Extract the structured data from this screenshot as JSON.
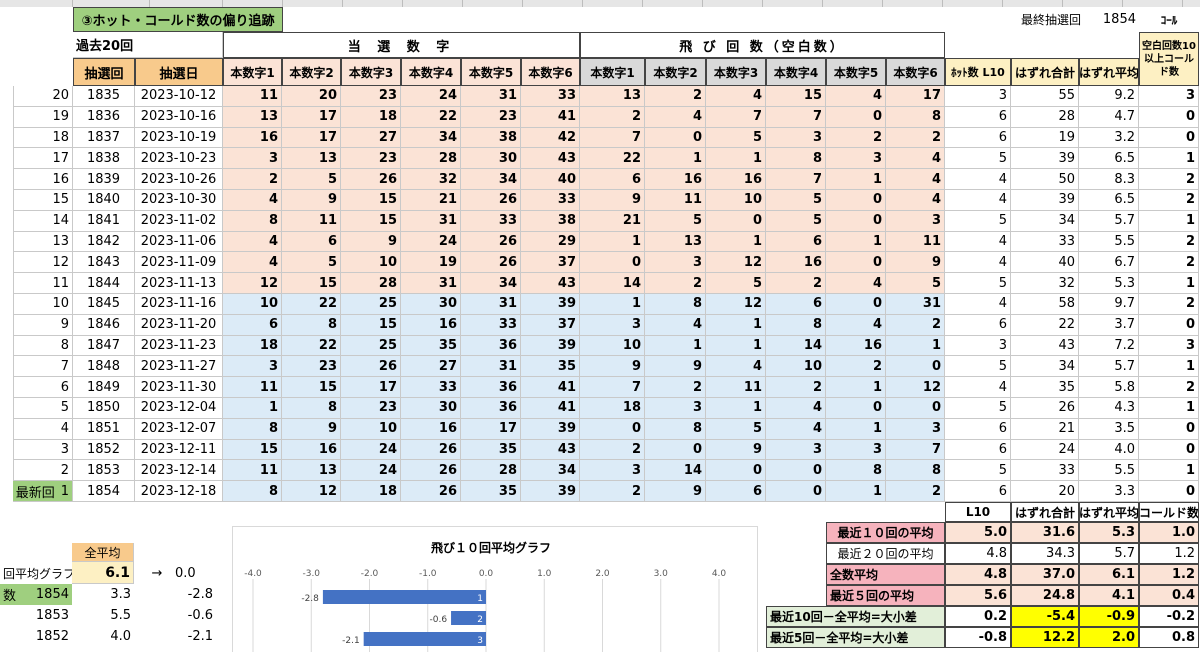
{
  "title": "③ホット・コールド数の偏り追跡",
  "last_draw_label": "最終抽選回",
  "last_draw_value": "1854",
  "cold_label": "ｺｰﾙ",
  "past_label": "過去20回",
  "winning_header": "当 選 数 字",
  "skip_header": "飛 び 回 数（空白数）",
  "blank_header": "空白回数10以上コールド数",
  "col_headers": {
    "draw": "抽選回",
    "date": "抽選日",
    "win": [
      "本数字1",
      "本数字2",
      "本数字3",
      "本数字4",
      "本数字5",
      "本数字6"
    ],
    "skip": [
      "本数字1",
      "本数字2",
      "本数字3",
      "本数字4",
      "本数字5",
      "本数字6"
    ],
    "hot": "ﾎｯﾄ数 L10",
    "miss_total": "はずれ合計",
    "miss_avg": "はずれ平均"
  },
  "latest_label": "最新回",
  "rows": [
    {
      "idx": "20",
      "draw": "1835",
      "date": "2023-10-12",
      "win": [
        "11",
        "20",
        "23",
        "24",
        "31",
        "33"
      ],
      "skip": [
        "13",
        "2",
        "4",
        "15",
        "4",
        "17"
      ],
      "hot": "3",
      "total": "55",
      "avg": "9.2",
      "cold": "3"
    },
    {
      "idx": "19",
      "draw": "1836",
      "date": "2023-10-16",
      "win": [
        "13",
        "17",
        "18",
        "22",
        "23",
        "41"
      ],
      "skip": [
        "2",
        "4",
        "7",
        "7",
        "0",
        "8"
      ],
      "hot": "6",
      "total": "28",
      "avg": "4.7",
      "cold": "0"
    },
    {
      "idx": "18",
      "draw": "1837",
      "date": "2023-10-19",
      "win": [
        "16",
        "17",
        "27",
        "34",
        "38",
        "42"
      ],
      "skip": [
        "7",
        "0",
        "5",
        "3",
        "2",
        "2"
      ],
      "hot": "6",
      "total": "19",
      "avg": "3.2",
      "cold": "0"
    },
    {
      "idx": "17",
      "draw": "1838",
      "date": "2023-10-23",
      "win": [
        "3",
        "13",
        "23",
        "28",
        "30",
        "43"
      ],
      "skip": [
        "22",
        "1",
        "1",
        "8",
        "3",
        "4"
      ],
      "hot": "5",
      "total": "39",
      "avg": "6.5",
      "cold": "1"
    },
    {
      "idx": "16",
      "draw": "1839",
      "date": "2023-10-26",
      "win": [
        "2",
        "5",
        "26",
        "32",
        "34",
        "40"
      ],
      "skip": [
        "6",
        "16",
        "16",
        "7",
        "1",
        "4"
      ],
      "hot": "4",
      "total": "50",
      "avg": "8.3",
      "cold": "2"
    },
    {
      "idx": "15",
      "draw": "1840",
      "date": "2023-10-30",
      "win": [
        "4",
        "9",
        "15",
        "21",
        "26",
        "33"
      ],
      "skip": [
        "9",
        "11",
        "10",
        "5",
        "0",
        "4"
      ],
      "hot": "4",
      "total": "39",
      "avg": "6.5",
      "cold": "2"
    },
    {
      "idx": "14",
      "draw": "1841",
      "date": "2023-11-02",
      "win": [
        "8",
        "11",
        "15",
        "31",
        "33",
        "38"
      ],
      "skip": [
        "21",
        "5",
        "0",
        "5",
        "0",
        "3"
      ],
      "hot": "5",
      "total": "34",
      "avg": "5.7",
      "cold": "1"
    },
    {
      "idx": "13",
      "draw": "1842",
      "date": "2023-11-06",
      "win": [
        "4",
        "6",
        "9",
        "24",
        "26",
        "29"
      ],
      "skip": [
        "1",
        "13",
        "1",
        "6",
        "1",
        "11"
      ],
      "hot": "4",
      "total": "33",
      "avg": "5.5",
      "cold": "2"
    },
    {
      "idx": "12",
      "draw": "1843",
      "date": "2023-11-09",
      "win": [
        "4",
        "5",
        "10",
        "19",
        "26",
        "37"
      ],
      "skip": [
        "0",
        "3",
        "12",
        "16",
        "0",
        "9"
      ],
      "hot": "4",
      "total": "40",
      "avg": "6.7",
      "cold": "2"
    },
    {
      "idx": "11",
      "draw": "1844",
      "date": "2023-11-13",
      "win": [
        "12",
        "15",
        "28",
        "31",
        "34",
        "43"
      ],
      "skip": [
        "14",
        "2",
        "5",
        "2",
        "4",
        "5"
      ],
      "hot": "5",
      "total": "32",
      "avg": "5.3",
      "cold": "1"
    },
    {
      "idx": "10",
      "draw": "1845",
      "date": "2023-11-16",
      "win": [
        "10",
        "22",
        "25",
        "30",
        "31",
        "39"
      ],
      "skip": [
        "1",
        "8",
        "12",
        "6",
        "0",
        "31"
      ],
      "hot": "4",
      "total": "58",
      "avg": "9.7",
      "cold": "2"
    },
    {
      "idx": "9",
      "draw": "1846",
      "date": "2023-11-20",
      "win": [
        "6",
        "8",
        "15",
        "16",
        "33",
        "37"
      ],
      "skip": [
        "3",
        "4",
        "1",
        "8",
        "4",
        "2"
      ],
      "hot": "6",
      "total": "22",
      "avg": "3.7",
      "cold": "0"
    },
    {
      "idx": "8",
      "draw": "1847",
      "date": "2023-11-23",
      "win": [
        "18",
        "22",
        "25",
        "35",
        "36",
        "39"
      ],
      "skip": [
        "10",
        "1",
        "1",
        "14",
        "16",
        "1"
      ],
      "hot": "3",
      "total": "43",
      "avg": "7.2",
      "cold": "3"
    },
    {
      "idx": "7",
      "draw": "1848",
      "date": "2023-11-27",
      "win": [
        "3",
        "23",
        "26",
        "27",
        "31",
        "35"
      ],
      "skip": [
        "9",
        "9",
        "4",
        "10",
        "2",
        "0"
      ],
      "hot": "5",
      "total": "34",
      "avg": "5.7",
      "cold": "1"
    },
    {
      "idx": "6",
      "draw": "1849",
      "date": "2023-11-30",
      "win": [
        "11",
        "15",
        "17",
        "33",
        "36",
        "41"
      ],
      "skip": [
        "7",
        "2",
        "11",
        "2",
        "1",
        "12"
      ],
      "hot": "4",
      "total": "35",
      "avg": "5.8",
      "cold": "2"
    },
    {
      "idx": "5",
      "draw": "1850",
      "date": "2023-12-04",
      "win": [
        "1",
        "8",
        "23",
        "30",
        "36",
        "41"
      ],
      "skip": [
        "18",
        "3",
        "1",
        "4",
        "0",
        "0"
      ],
      "hot": "5",
      "total": "26",
      "avg": "4.3",
      "cold": "1"
    },
    {
      "idx": "4",
      "draw": "1851",
      "date": "2023-12-07",
      "win": [
        "8",
        "9",
        "10",
        "16",
        "17",
        "39"
      ],
      "skip": [
        "0",
        "8",
        "5",
        "4",
        "1",
        "3"
      ],
      "hot": "6",
      "total": "21",
      "avg": "3.5",
      "cold": "0"
    },
    {
      "idx": "3",
      "draw": "1852",
      "date": "2023-12-11",
      "win": [
        "15",
        "16",
        "24",
        "26",
        "35",
        "43"
      ],
      "skip": [
        "2",
        "0",
        "9",
        "3",
        "3",
        "7"
      ],
      "hot": "6",
      "total": "24",
      "avg": "4.0",
      "cold": "0"
    },
    {
      "idx": "2",
      "draw": "1853",
      "date": "2023-12-14",
      "win": [
        "11",
        "13",
        "24",
        "26",
        "28",
        "34"
      ],
      "skip": [
        "3",
        "14",
        "0",
        "0",
        "8",
        "8"
      ],
      "hot": "5",
      "total": "33",
      "avg": "5.5",
      "cold": "1"
    },
    {
      "idx": "1",
      "draw": "1854",
      "date": "2023-12-18",
      "win": [
        "8",
        "12",
        "18",
        "26",
        "35",
        "39"
      ],
      "skip": [
        "2",
        "9",
        "6",
        "0",
        "1",
        "2"
      ],
      "hot": "6",
      "total": "20",
      "avg": "3.3",
      "cold": "0"
    }
  ],
  "summary": {
    "headers": [
      "L10",
      "はずれ合計",
      "はずれ平均",
      "コールド数"
    ],
    "rows": [
      {
        "label": "最近１０回の平均",
        "v": [
          "5.0",
          "31.6",
          "5.3",
          "1.0"
        ]
      },
      {
        "label": "最近２０回の平均",
        "v": [
          "4.8",
          "34.3",
          "5.7",
          "1.2"
        ]
      },
      {
        "label": "全数平均",
        "v": [
          "4.8",
          "37.0",
          "6.1",
          "1.2"
        ]
      },
      {
        "label": "最近５回の平均",
        "v": [
          "5.6",
          "24.8",
          "4.1",
          "0.4"
        ]
      },
      {
        "label": "最近10回－全平均=大小差",
        "v": [
          "0.2",
          "-5.4",
          "-0.9",
          "-0.2"
        ]
      },
      {
        "label": "最近5回－全平均=大小差",
        "v": [
          "-0.8",
          "12.2",
          "2.0",
          "0.8"
        ]
      }
    ]
  },
  "left_panel": {
    "all_avg_label": "全平均",
    "all_avg_value": "6.1",
    "arrow": "→",
    "arrow_value": "0.0",
    "graph_label": "回平均グラフ",
    "count_label": "数",
    "rows": [
      {
        "draw": "1854",
        "avg": "3.3",
        "diff": "-2.8"
      },
      {
        "draw": "1853",
        "avg": "5.5",
        "diff": "-0.6"
      },
      {
        "draw": "1852",
        "avg": "4.0",
        "diff": "-2.1"
      }
    ]
  },
  "chart_data": {
    "type": "bar",
    "orientation": "horizontal",
    "title": "飛び１０回平均グラフ",
    "x_ticks": [
      "-4.0",
      "-3.0",
      "-2.0",
      "-1.0",
      "0.0",
      "1.0",
      "2.0",
      "3.0",
      "4.0"
    ],
    "xlim": [
      -4,
      4
    ],
    "categories": [
      "1",
      "2",
      "3"
    ],
    "values": [
      -2.8,
      -0.6,
      -2.1
    ],
    "data_labels": [
      "-2.8",
      "-0.6",
      "-2.1"
    ],
    "bar_color": "#4472c4"
  }
}
